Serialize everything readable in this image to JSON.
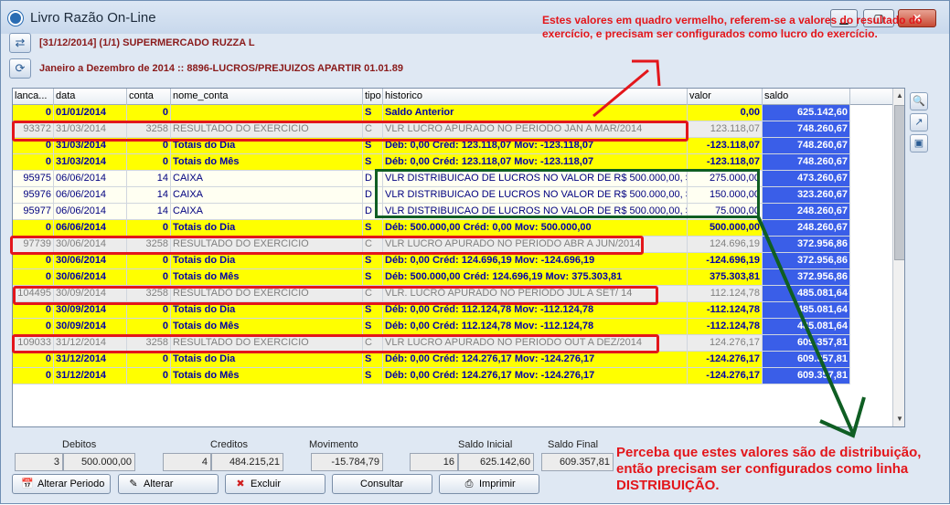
{
  "window": {
    "title": "Livro Razão On-Line",
    "minimize": "▁",
    "maximize": "▢",
    "close": "✕"
  },
  "header": {
    "line1": "[31/12/2014] (1/1) SUPERMERCADO RUZZA L",
    "line2": "Janeiro a Dezembro de 2014 :: 8896-LUCROS/PREJUIZOS APARTIR 01.01.89"
  },
  "table": {
    "columns": [
      "lanca...",
      "data",
      "conta",
      "nome_conta",
      "tipo",
      "historico",
      "valor",
      "saldo"
    ],
    "rows": [
      {
        "kind": "y",
        "lanc": "0",
        "data": "01/01/2014",
        "conta": "0",
        "nome": "",
        "tipo": "S",
        "hist": "Saldo Anterior",
        "valor": "0,00",
        "saldo": "625.142,60"
      },
      {
        "kind": "g",
        "lanc": "93372",
        "data": "31/03/2014",
        "conta": "3258",
        "nome": "RESULTADO DO EXERCICIO",
        "tipo": "C",
        "hist": "VLR LUCRO APURADO NO PERIODO JAN  A MAR/2014",
        "valor": "123.118,07",
        "saldo": "748.260,67"
      },
      {
        "kind": "y",
        "lanc": "0",
        "data": "31/03/2014",
        "conta": "0",
        "nome": "Totais do Dia",
        "tipo": "S",
        "hist": "Déb: 0,00  Créd: 123.118,07  Mov: -123.118,07",
        "valor": "-123.118,07",
        "saldo": "748.260,67"
      },
      {
        "kind": "y",
        "lanc": "0",
        "data": "31/03/2014",
        "conta": "0",
        "nome": "Totais do Mês",
        "tipo": "S",
        "hist": "Déb: 0,00  Créd: 123.118,07  Mov: -123.118,07",
        "valor": "-123.118,07",
        "saldo": "748.260,67"
      },
      {
        "kind": "w",
        "lanc": "95975",
        "data": "06/06/2014",
        "conta": "14",
        "nome": "CAIXA",
        "tipo": "D",
        "hist": "VLR DISTRIBUICAO DE LUCROS  NO VALOR DE R$ 500.000,00, SEND",
        "valor": "275.000,00",
        "saldo": "473.260,67"
      },
      {
        "kind": "w",
        "lanc": "95976",
        "data": "06/06/2014",
        "conta": "14",
        "nome": "CAIXA",
        "tipo": "D",
        "hist": "VLR DISTRIBUICAO DE LUCROS  NO VALOR DE R$ 500.000,00, SEND",
        "valor": "150.000,00",
        "saldo": "323.260,67"
      },
      {
        "kind": "w",
        "lanc": "95977",
        "data": "06/06/2014",
        "conta": "14",
        "nome": "CAIXA",
        "tipo": "D",
        "hist": "VLR DISTRIBUICAO DE LUCROS  NO VALOR DE R$ 500.000,00, SEND",
        "valor": "75.000,00",
        "saldo": "248.260,67"
      },
      {
        "kind": "y",
        "lanc": "0",
        "data": "06/06/2014",
        "conta": "0",
        "nome": "Totais do Dia",
        "tipo": "S",
        "hist": "Déb: 500.000,00  Créd: 0,00  Mov: 500.000,00",
        "valor": "500.000,00",
        "saldo": "248.260,67"
      },
      {
        "kind": "g",
        "lanc": "97739",
        "data": "30/06/2014",
        "conta": "3258",
        "nome": "RESULTADO DO EXERCICIO",
        "tipo": "C",
        "hist": "VLR LUCRO APURADO NO PERIODO ABR A JUN/2014",
        "valor": "124.696,19",
        "saldo": "372.956,86"
      },
      {
        "kind": "y",
        "lanc": "0",
        "data": "30/06/2014",
        "conta": "0",
        "nome": "Totais do Dia",
        "tipo": "S",
        "hist": "Déb: 0,00  Créd: 124.696,19  Mov: -124.696,19",
        "valor": "-124.696,19",
        "saldo": "372.956,86"
      },
      {
        "kind": "y",
        "lanc": "0",
        "data": "30/06/2014",
        "conta": "0",
        "nome": "Totais do Mês",
        "tipo": "S",
        "hist": "Déb: 500.000,00  Créd: 124.696,19  Mov: 375.303,81",
        "valor": "375.303,81",
        "saldo": "372.956,86"
      },
      {
        "kind": "g",
        "lanc": "104495",
        "data": "30/09/2014",
        "conta": "3258",
        "nome": "RESULTADO DO EXERCICIO",
        "tipo": "C",
        "hist": "VLR. LUCRO APURADO NO PERIODO JUL A SET/ 14",
        "valor": "112.124,78",
        "saldo": "485.081,64"
      },
      {
        "kind": "y",
        "lanc": "0",
        "data": "30/09/2014",
        "conta": "0",
        "nome": "Totais do Dia",
        "tipo": "S",
        "hist": "Déb: 0,00  Créd: 112.124,78  Mov: -112.124,78",
        "valor": "-112.124,78",
        "saldo": "485.081,64"
      },
      {
        "kind": "y",
        "lanc": "0",
        "data": "30/09/2014",
        "conta": "0",
        "nome": "Totais do Mês",
        "tipo": "S",
        "hist": "Déb: 0,00  Créd: 112.124,78  Mov: -112.124,78",
        "valor": "-112.124,78",
        "saldo": "485.081,64"
      },
      {
        "kind": "g",
        "lanc": "109033",
        "data": "31/12/2014",
        "conta": "3258",
        "nome": "RESULTADO DO EXERCICIO",
        "tipo": "C",
        "hist": "VLR LUCRO APURADO NO PERIODO OUT A DEZ/2014",
        "valor": "124.276,17",
        "saldo": "609.357,81"
      },
      {
        "kind": "y",
        "lanc": "0",
        "data": "31/12/2014",
        "conta": "0",
        "nome": "Totais do Dia",
        "tipo": "S",
        "hist": "Déb: 0,00  Créd: 124.276,17  Mov: -124.276,17",
        "valor": "-124.276,17",
        "saldo": "609.357,81"
      },
      {
        "kind": "y",
        "lanc": "0",
        "data": "31/12/2014",
        "conta": "0",
        "nome": "Totais do Mês",
        "tipo": "S",
        "hist": "Déb: 0,00  Créd: 124.276,17  Mov: -124.276,17",
        "valor": "-124.276,17",
        "saldo": "609.357,81"
      }
    ]
  },
  "footer": {
    "debitos_label": "Debitos",
    "debitos_count": "3",
    "debitos_value": "500.000,00",
    "creditos_label": "Creditos",
    "creditos_count": "4",
    "creditos_value": "484.215,21",
    "movimento_label": "Movimento",
    "movimento_value": "-15.784,79",
    "saldo_inicial_label": "Saldo Inicial",
    "saldo_inicial_count": "16",
    "saldo_inicial_value": "625.142,60",
    "saldo_final_label": "Saldo Final",
    "saldo_final_value": "609.357,81"
  },
  "buttons": {
    "alterar_periodo": "Alterar Periodo",
    "alterar": "Alterar",
    "excluir": "Excluir",
    "consultar": "Consultar",
    "imprimir": "Imprimir"
  },
  "annotations": {
    "top": "Estes valores em quadro vermelho, referem-se a valores do resultado do exercício, e precisam ser configurados como lucro do exercício.",
    "bottom": "Perceba que estes valores são de distribuição, então precisam ser configurados como linha DISTRIBUIÇÃO."
  },
  "colors": {
    "total_row": "#ffff00",
    "saldo_cell": "#3a5ee8",
    "highlight_red": "#e3161b",
    "highlight_green": "#0f5e23"
  }
}
